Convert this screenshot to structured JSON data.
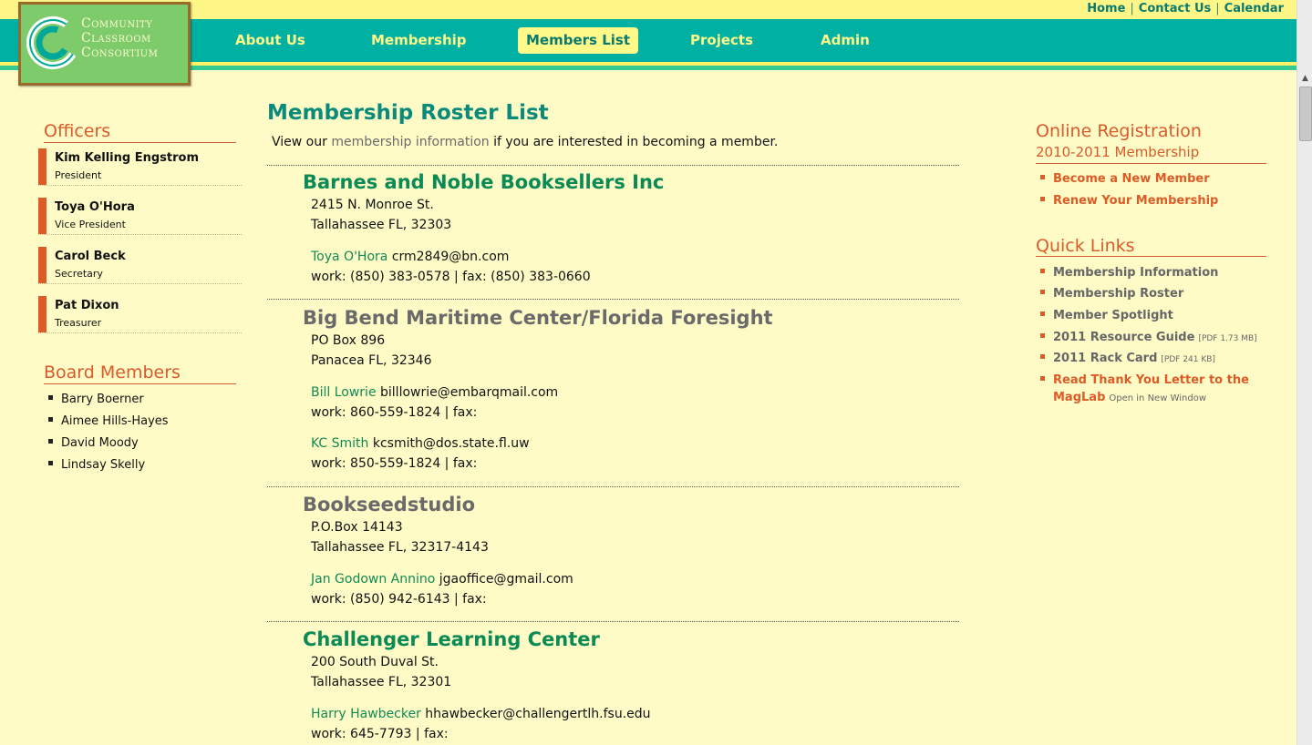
{
  "header": {
    "top_links": [
      "Home",
      "Contact Us",
      "Calendar"
    ],
    "logo_lines": [
      "Community",
      "Classroom",
      "Consortium"
    ],
    "nav": [
      {
        "label": "About Us"
      },
      {
        "label": "Membership"
      },
      {
        "label": "Members List",
        "active": true
      },
      {
        "label": "Projects"
      },
      {
        "label": "Admin"
      }
    ]
  },
  "sidebar": {
    "officers_heading": "Officers",
    "officers": [
      {
        "name": "Kim Kelling Engstrom",
        "role": "President"
      },
      {
        "name": "Toya O'Hora",
        "role": "Vice President"
      },
      {
        "name": "Carol Beck",
        "role": "Secretary"
      },
      {
        "name": "Pat Dixon",
        "role": "Treasurer"
      }
    ],
    "board_heading": "Board Members",
    "board": [
      "Barry Boerner",
      "Aimee Hills-Hayes",
      "David Moody",
      "Lindsay Skelly"
    ]
  },
  "main": {
    "title": "Membership Roster List",
    "intro_pre": "View our",
    "intro_link": "membership information",
    "intro_post": "if you are interested in becoming a member.",
    "members": [
      {
        "org": "Barnes and Noble Booksellers Inc",
        "address1": "2415 N. Monroe St.",
        "address2": "Tallahassee FL, 32303",
        "contacts": [
          {
            "name": "Toya O'Hora",
            "email": "crm2849@bn.com",
            "phones": "work: (850) 383-0578 | fax: (850) 383-0660"
          }
        ]
      },
      {
        "org": "Big Bend Maritime Center/Florida Foresight",
        "address1": "PO Box 896",
        "address2": "Panacea FL, 32346",
        "contacts": [
          {
            "name": "Bill Lowrie",
            "email": "billlowrie@embarqmail.com",
            "phones": "work: 860-559-1824 | fax:"
          },
          {
            "name": "KC Smith",
            "email": "kcsmith@dos.state.fl.uw",
            "phones": "work: 850-559-1824 | fax:"
          }
        ]
      },
      {
        "org": "Bookseedstudio",
        "address1": "P.O.Box 14143",
        "address2": "Tallahassee FL, 32317-4143",
        "contacts": [
          {
            "name": "Jan Godown Annino",
            "email": "jgaoffice@gmail.com",
            "phones": "work: (850) 942-6143 | fax:"
          }
        ]
      },
      {
        "org": "Challenger Learning Center",
        "address1": "200 South Duval St.",
        "address2": "Tallahassee FL, 32301",
        "contacts": [
          {
            "name": "Harry Hawbecker",
            "email": "hhawbecker@challengertlh.fsu.edu",
            "phones": "work: 645-7793 | fax:"
          }
        ]
      }
    ]
  },
  "right": {
    "reg_heading": "Online Registration",
    "reg_sub": "2010-2011 Membership",
    "reg_links": [
      "Become a New Member",
      "Renew Your Membership"
    ],
    "quick_heading": "Quick Links",
    "quick_links": [
      {
        "label": "Membership Information"
      },
      {
        "label": "Membership Roster"
      },
      {
        "label": "Member Spotlight"
      },
      {
        "label": "2011 Resource Guide",
        "meta": "[PDF 1.73 MB]"
      },
      {
        "label": "2011 Rack Card",
        "meta": "[PDF 241 KB]"
      },
      {
        "label": "Read Thank You Letter to the",
        "label2": "MagLab",
        "meta": "Open in New Window"
      }
    ]
  }
}
